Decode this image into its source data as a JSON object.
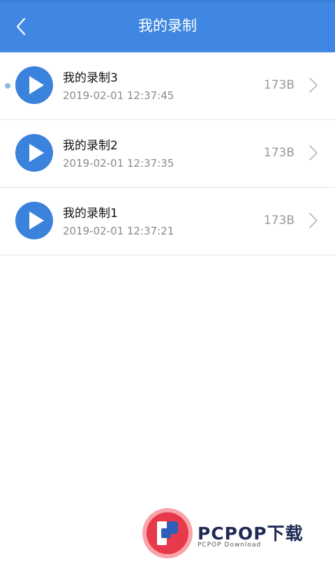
{
  "header": {
    "title": "我的录制",
    "back_icon": "chevron-left-icon",
    "background": "#3f87e2"
  },
  "recordings": [
    {
      "name": "我的录制3",
      "datetime": "2019-02-01 12:37:45",
      "size": "173B",
      "unread": true
    },
    {
      "name": "我的录制2",
      "datetime": "2019-02-01 12:37:35",
      "size": "173B",
      "unread": false
    },
    {
      "name": "我的录制1",
      "datetime": "2019-02-01 12:37:21",
      "size": "173B",
      "unread": false
    }
  ],
  "icons": {
    "play": "play-icon",
    "chevron": "chevron-right-icon"
  },
  "colors": {
    "accent": "#3f87e2",
    "play_circle": "#3b82dc",
    "unread_dot": "#8fb7e6"
  },
  "watermark": {
    "brand": "PCPOP下载",
    "sub": "PCPOP Download"
  }
}
